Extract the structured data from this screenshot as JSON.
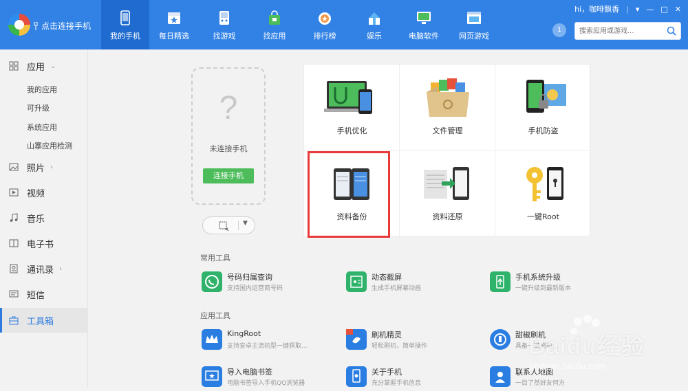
{
  "app": {
    "connect_link": "点击连接手机",
    "user_greeting": "hi，咖啡飘香",
    "message_badge": "1",
    "search": {
      "placeholder": "搜索应用或游戏..."
    }
  },
  "nav": {
    "items": [
      {
        "label": "我的手机",
        "icon": "phone-icon",
        "active": true
      },
      {
        "label": "每日精选",
        "icon": "calendar-star-icon"
      },
      {
        "label": "找游戏",
        "icon": "gamepad-icon"
      },
      {
        "label": "找应用",
        "icon": "shopping-bag-icon"
      },
      {
        "label": "排行榜",
        "icon": "medal-icon"
      },
      {
        "label": "娱乐",
        "icon": "gift-box-icon"
      },
      {
        "label": "电脑软件",
        "icon": "monitor-icon"
      },
      {
        "label": "网页游戏",
        "icon": "web-game-icon"
      }
    ]
  },
  "sidebar": {
    "apps_label": "应用",
    "app_subitems": [
      "我的应用",
      "可升级",
      "系统应用",
      "山寨应用检测"
    ],
    "photos_label": "照片",
    "video_label": "视频",
    "music_label": "音乐",
    "ebook_label": "电子书",
    "contacts_label": "通讯录",
    "sms_label": "短信",
    "toolbox_label": "工具箱"
  },
  "device": {
    "not_connected": "未连接手机",
    "connect_button": "连接手机",
    "question_mark": "?"
  },
  "tiles": [
    {
      "label": "手机优化",
      "icon": "phone-optimize-icon"
    },
    {
      "label": "文件管理",
      "icon": "file-manager-icon"
    },
    {
      "label": "手机防盗",
      "icon": "anti-theft-icon"
    },
    {
      "label": "资料备份",
      "icon": "data-backup-icon"
    },
    {
      "label": "资料还原",
      "icon": "data-restore-icon"
    },
    {
      "label": "一键Root",
      "icon": "root-key-icon"
    }
  ],
  "common_tools": {
    "title": "常用工具",
    "items": [
      {
        "name": "号码归属查询",
        "desc": "支持国内运营商号码",
        "color": "#2fb36a"
      },
      {
        "name": "动态截屏",
        "desc": "生成手机屏幕动画",
        "color": "#2fb36a"
      },
      {
        "name": "手机系统升级",
        "desc": "一键升级到最新版本",
        "color": "#2fb36a"
      }
    ]
  },
  "app_tools": {
    "title": "应用工具",
    "items": [
      {
        "name": "KingRoot",
        "desc": "支持安卓主流机型一键获取...",
        "color": "#2a7de1"
      },
      {
        "name": "刷机精灵",
        "desc": "轻松刷机，简单操作",
        "color": "#2a7de1"
      },
      {
        "name": "甜椒刷机",
        "desc": "具备一键刷机...",
        "color": "#2a7de1"
      },
      {
        "name": "导入电脑书签",
        "desc": "电脑书签导入手机QQ浏览器",
        "color": "#2a7de1"
      },
      {
        "name": "关于手机",
        "desc": "充分掌握手机信息",
        "color": "#2a7de1"
      },
      {
        "name": "联系人地图",
        "desc": "一目了然好友何方",
        "color": "#2a7de1"
      }
    ]
  },
  "watermark": {
    "text": "Baidu经验",
    "url": "jingyan.baidu.com"
  },
  "colors": {
    "topbar": "#3282e6",
    "active_nav": "#1f6bd0",
    "connect_button": "#4cbd5a",
    "highlight": "#e83838"
  }
}
